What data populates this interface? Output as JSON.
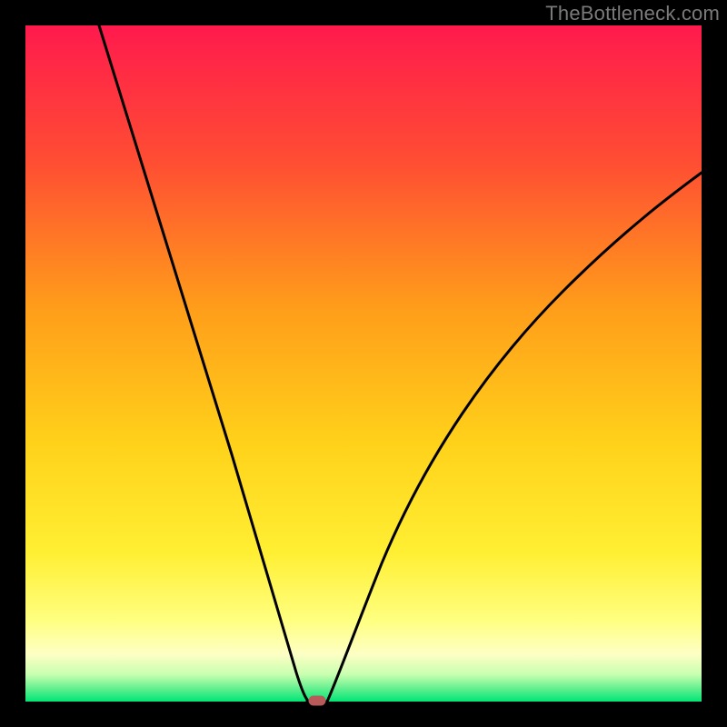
{
  "watermark": "TheBottleneck.com",
  "chart_data": {
    "type": "line",
    "title": "",
    "xlabel": "",
    "ylabel": "",
    "xlim": [
      0,
      100
    ],
    "ylim": [
      0,
      100
    ],
    "background_gradient": {
      "top": "#ff1a4d",
      "mid_upper": "#ff8a00",
      "mid": "#ffe600",
      "mid_lower": "#ffff8a",
      "bottom": "#00e676"
    },
    "curve": {
      "minimum_x": 41,
      "minimum_y": 0,
      "left_branch_top_x": 11,
      "left_branch_top_y": 100,
      "right_branch_top_x": 100,
      "right_branch_top_y": 71,
      "flat_segment": {
        "x_start": 40,
        "x_end": 43,
        "y": 0
      }
    },
    "marker": {
      "x": 42,
      "y": 0,
      "shape": "rounded-rect",
      "color": "#c15a5a"
    },
    "series": [
      {
        "name": "bottleneck-curve",
        "points": [
          {
            "x": 11,
            "y": 100
          },
          {
            "x": 14,
            "y": 90
          },
          {
            "x": 17,
            "y": 80
          },
          {
            "x": 20,
            "y": 70
          },
          {
            "x": 23,
            "y": 60
          },
          {
            "x": 26,
            "y": 50
          },
          {
            "x": 29,
            "y": 40
          },
          {
            "x": 32,
            "y": 30
          },
          {
            "x": 35,
            "y": 20
          },
          {
            "x": 38,
            "y": 10
          },
          {
            "x": 40,
            "y": 2
          },
          {
            "x": 41,
            "y": 0
          },
          {
            "x": 43,
            "y": 0
          },
          {
            "x": 46,
            "y": 8
          },
          {
            "x": 50,
            "y": 18
          },
          {
            "x": 55,
            "y": 28
          },
          {
            "x": 60,
            "y": 36
          },
          {
            "x": 65,
            "y": 43
          },
          {
            "x": 70,
            "y": 50
          },
          {
            "x": 75,
            "y": 55
          },
          {
            "x": 80,
            "y": 60
          },
          {
            "x": 85,
            "y": 64
          },
          {
            "x": 90,
            "y": 67
          },
          {
            "x": 95,
            "y": 69
          },
          {
            "x": 100,
            "y": 71
          }
        ]
      }
    ]
  }
}
